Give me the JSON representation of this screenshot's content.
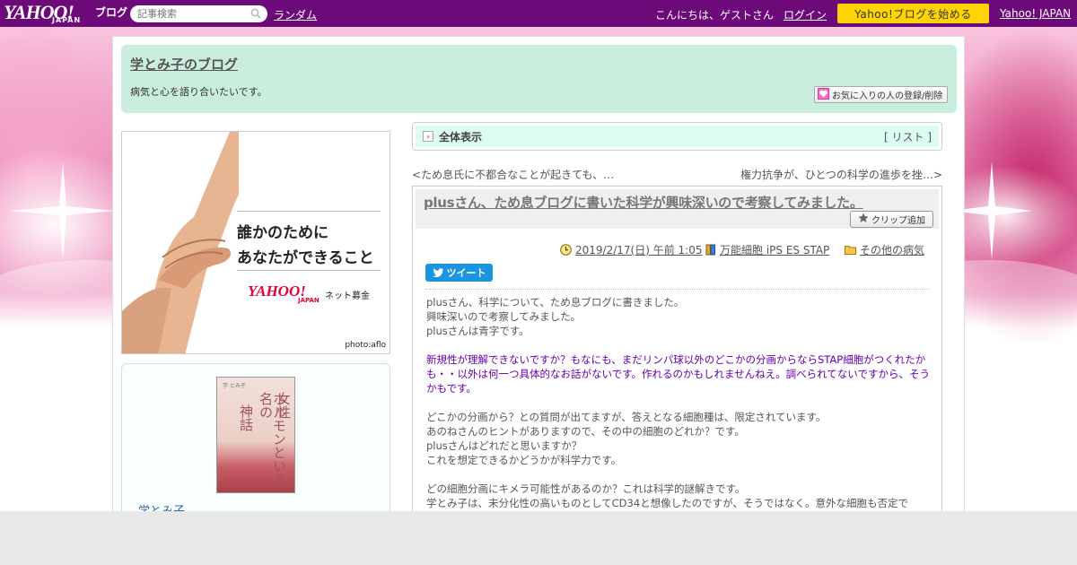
{
  "topbar": {
    "logo_text": "YAHOO!",
    "logo_sub": "JAPAN",
    "logo_blog": "ブログ",
    "search_placeholder": "記事検索",
    "random_link": "ランダム",
    "greeting": "こんにちは、ゲストさん",
    "login_link": "ログイン",
    "start_button": "Yahoo!ブログを始める",
    "yahoo_japan_link": "Yahoo! JAPAN"
  },
  "header": {
    "blog_title": "学とみ子のブログ",
    "description": "病気と心を語り合いたいです。",
    "favorite_button": "お気に入りの人の登録/削除"
  },
  "banner": {
    "copy_line1": "誰かのために",
    "copy_line2": "あなたができること",
    "logo": "YAHOO!",
    "logo_sub": "JAPAN",
    "service": "ネット募金",
    "credit": "photo:aflo"
  },
  "profile": {
    "book_title_1": "女性",
    "book_title_2": "ホルモンという名の",
    "book_title_3": "神話",
    "book_author": "学 とみ子",
    "name": "学とみ子"
  },
  "view_bar": {
    "label": "全体表示",
    "list_open": "[",
    "list_link": "リスト",
    "list_close": "]"
  },
  "nav": {
    "prev_bracket": "<",
    "prev_link": "ため息氏に不都合なことが起きても、",
    "prev_ellipsis": "…",
    "next_link": "権力抗争が、ひとつの科学の進歩を挫",
    "next_ellipsis": "…",
    "next_bracket": ">"
  },
  "article": {
    "title": "plusさん、ため息ブログに書いた科学が興味深いので考察してみました。",
    "clip_button": "クリップ追加",
    "date": "2019/2/17(日) 午前 1:05",
    "category_book": "万能細胞 iPS ES STAP",
    "category_folder": "その他の病気",
    "tweet_button": "ツイート",
    "body": {
      "p1": "plusさん、科学について、ため息ブログに書きました。",
      "p2": "興味深いので考察してみました。",
      "p3": "plusさんは青字です。",
      "q1": "新規性が理解できないですか？もなにも、まだリンパ球以外のどこかの分画からならSTAP細胞がつくれたかも・・以外は何一つ具体的なお話がないです。作れるのかもしれませんねえ。調べられてないですから、そうかもです。",
      "p4": "どこかの分画から？との質問が出てますが、答えとなる細胞種は、限定されています。",
      "p5": "あのねさんのヒントがありますので、その中の細胞のどれか？です。",
      "p6": "plusさんはどれだと思いますか？",
      "p7": "これを想定できるかどうかが科学力です。",
      "p8": "どの細胞分画にキメラ可能性があるのか？これは科学的謎解きです。",
      "p9": "学とみ子は、未分化性の高いものとしてCD34と想像したのですが、そうではなく。意外な細胞も否定で"
    }
  },
  "colors": {
    "topbar": "#6d0a79",
    "header_bg": "#caeedd",
    "view_bar_bg": "#dbfbf3",
    "start_button": "#ffd400",
    "tweet": "#1b95e0",
    "quote": "#6600aa"
  },
  "icons": {
    "search": "magnifier-icon",
    "heart": "heart-icon",
    "star": "star-icon",
    "clock": "clock-icon",
    "book": "book-icon",
    "folder": "folder-icon",
    "twitter": "twitter-bird-icon",
    "arrow": "chevron-right-icon"
  }
}
